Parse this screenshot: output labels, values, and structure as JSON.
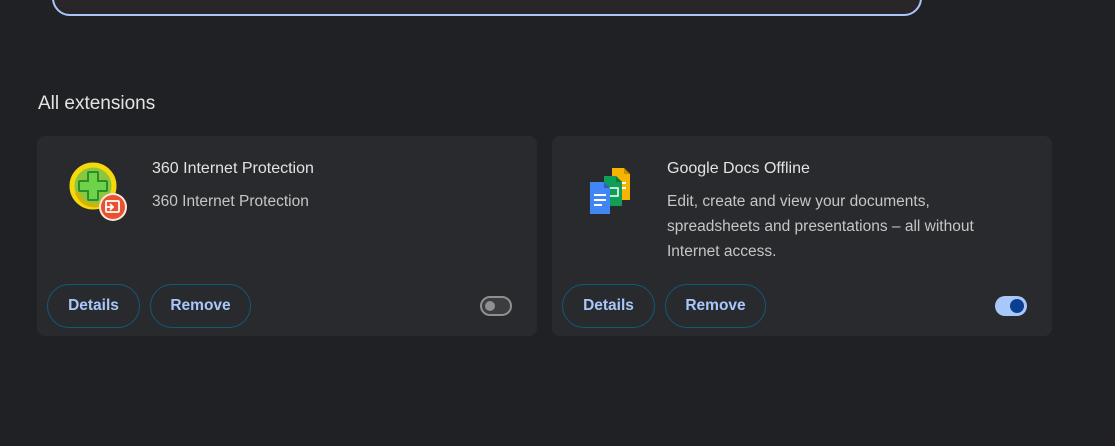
{
  "section": {
    "title": "All extensions"
  },
  "extensions": [
    {
      "name": "360 Internet Protection",
      "description": "360 Internet Protection",
      "icon": "360-internet-protection-icon",
      "enabled": false,
      "details_label": "Details",
      "remove_label": "Remove"
    },
    {
      "name": "Google Docs Offline",
      "description": "Edit, create and view your documents, spreadsheets and presentations – all without Internet access.",
      "icon": "google-docs-offline-icon",
      "enabled": true,
      "details_label": "Details",
      "remove_label": "Remove"
    }
  ],
  "colors": {
    "background": "#202124",
    "card": "#292a2d",
    "accent": "#a8c7fa",
    "toggle_on_knob": "#0b3f91"
  }
}
